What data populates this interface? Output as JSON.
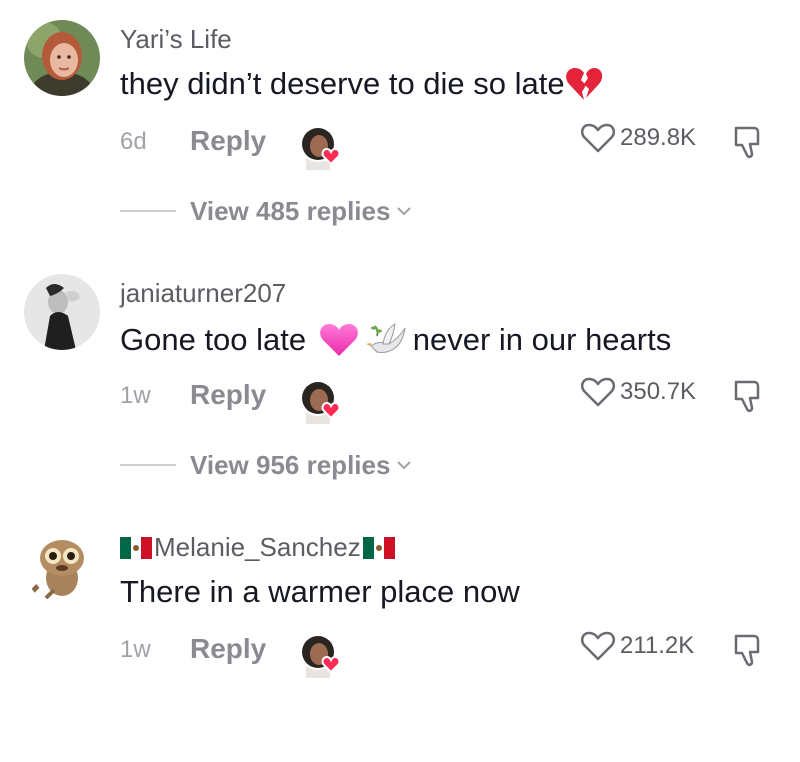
{
  "comments": [
    {
      "username": "Yari’s Life",
      "text_before": "they didn’t deserve to die so late",
      "text_after": "",
      "time": "6d",
      "reply_label": "Reply",
      "likes": "289.8K",
      "view_replies": "View 485 replies",
      "emoji": "broken-heart"
    },
    {
      "username": "janiaturner207",
      "text_before": "Gone too late ",
      "text_after": "never in our hearts",
      "time": "1w",
      "reply_label": "Reply",
      "likes": "350.7K",
      "view_replies": "View 956 replies",
      "emoji": "pink-heart-dove"
    },
    {
      "username": "Melanie_Sanchez",
      "text_before": "There in a warmer place now",
      "text_after": "",
      "time": "1w",
      "reply_label": "Reply",
      "likes": "211.2K",
      "emoji": "none"
    }
  ],
  "colors": {
    "username": "#5c5c63",
    "text": "#161823",
    "muted": "#8a8b91",
    "heart_pink": "#fe2c55"
  }
}
